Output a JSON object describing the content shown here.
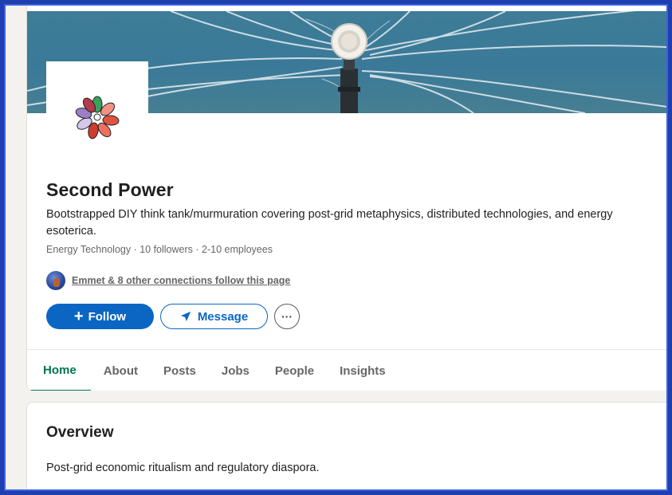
{
  "company": {
    "name": "Second Power",
    "tagline": "Bootstrapped DIY think tank/murmuration covering post-grid metaphysics, distributed technologies, and energy esoterica.",
    "meta": "Energy Technology · 10 followers · 2-10 employees",
    "connections_text": "Emmet & 8 other connections follow this page"
  },
  "actions": {
    "follow_label": "Follow",
    "message_label": "Message",
    "more_label": "···"
  },
  "tabs": [
    {
      "label": "Home",
      "active": true
    },
    {
      "label": "About"
    },
    {
      "label": "Posts"
    },
    {
      "label": "Jobs"
    },
    {
      "label": "People"
    },
    {
      "label": "Insights"
    }
  ],
  "overview": {
    "heading": "Overview",
    "text": "Post-grid economic ritualism and regulatory diaspora."
  },
  "colors": {
    "primary": "#0a66c2",
    "active_tab": "#01754f",
    "frame": "#1f3fb0"
  }
}
